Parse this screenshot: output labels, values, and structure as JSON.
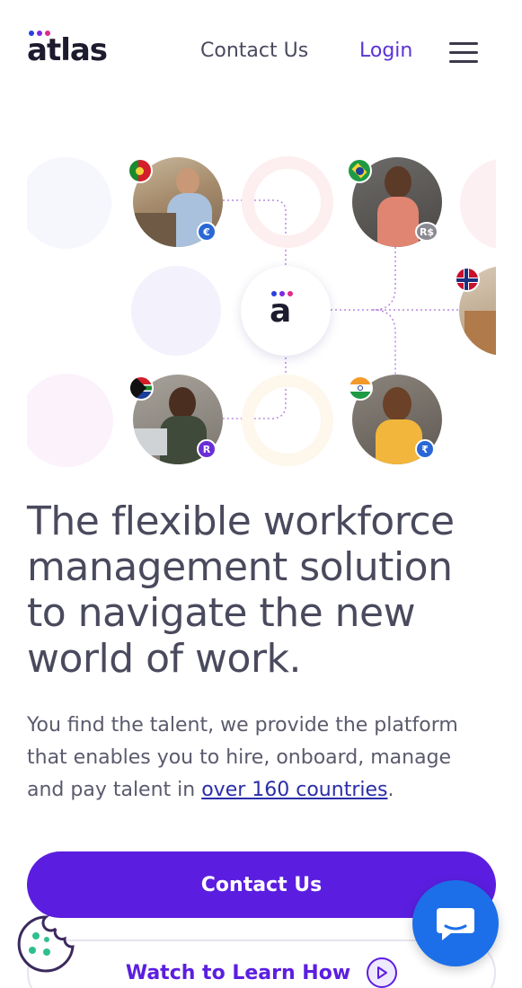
{
  "header": {
    "logo_text": "atlas",
    "nav_contact": "Contact Us",
    "nav_login": "Login",
    "menu_icon": "hamburger-menu-icon"
  },
  "hero": {
    "center_logo_letter": "a",
    "badges": {
      "portugal": "€",
      "brazil": "R$",
      "south_africa": "R",
      "india": "₹"
    }
  },
  "headline": {
    "line1": "The flexible workforce",
    "line2": "management solution",
    "line3": "to navigate the new",
    "line4": "world of work."
  },
  "sub": {
    "before_link": "You find the talent, we provide the platform that enables you to hire, onboard, manage and pay talent in ",
    "link": "over 160 countries",
    "after_link": "."
  },
  "buttons": {
    "primary": "Contact Us",
    "secondary": "Watch to Learn How"
  },
  "colors": {
    "brand": "#5b1ee0",
    "link": "#2a2ea8",
    "chat": "#1c6fe8",
    "text": "#4a4a5e"
  }
}
